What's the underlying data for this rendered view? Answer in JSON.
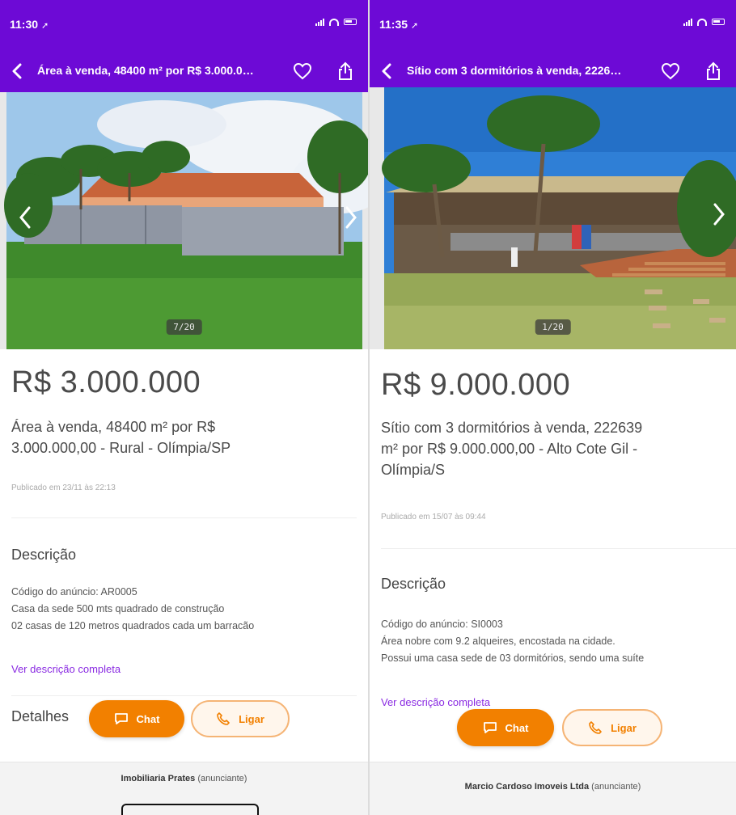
{
  "left": {
    "status": {
      "time": "11:30"
    },
    "header": {
      "title": "Área à venda, 48400 m² por R$ 3.000.000,00 - Rural - Olímpia/SP"
    },
    "gallery": {
      "counter": "7/20"
    },
    "listing": {
      "price": "R$ 3.000.000",
      "title_line1": "Área à venda, 48400 m² por R$",
      "title_line2": "3.000.000,00 - Rural - Olímpia/SP",
      "published": "Publicado em 23/11 às 22:13"
    },
    "description": {
      "heading": "Descrição",
      "lines": [
        "Código do anúncio: AR0005",
        "Casa da sede 500 mts quadrado de construção",
        "02 casas de 120 metros quadrados cada um barracão"
      ],
      "more_link": "Ver descrição completa"
    },
    "details": {
      "heading": "Detalhes"
    },
    "actions": {
      "chat_label": "Chat",
      "call_label": "Ligar"
    },
    "footer": {
      "advertiser_name": "Imobiliaria Prates",
      "advertiser_role": "(anunciante)"
    }
  },
  "right": {
    "status": {
      "time": "11:35"
    },
    "header": {
      "title": "Sítio com 3 dormitórios à venda, 222639 m²"
    },
    "gallery": {
      "counter": "1/20"
    },
    "listing": {
      "price": "R$ 9.000.000",
      "title_line1": "Sítio com 3 dormitórios à venda, 222639",
      "title_line2": "m² por R$ 9.000.000,00 - Alto Cote Gil -",
      "title_line3": "Olímpia/S",
      "published": "Publicado em 15/07 às 09:44"
    },
    "description": {
      "heading": "Descrição",
      "lines": [
        "Código do anúncio: SI0003",
        "Área nobre com 9.2 alqueires, encostada na cidade.",
        "Possui uma casa sede de 03 dormitórios, sendo uma suíte"
      ],
      "more_link": "Ver descrição completa"
    },
    "actions": {
      "chat_label": "Chat",
      "call_label": "Ligar"
    },
    "footer": {
      "advertiser_name": "Marcio Cardoso Imoveis Ltda",
      "advertiser_role": "(anunciante)"
    }
  },
  "colors": {
    "brand_purple": "#6d0ad6",
    "accent_orange": "#f28000",
    "link_purple": "#8a2be2"
  },
  "icons": [
    "back-arrow-icon",
    "heart-icon",
    "share-icon",
    "chevron-left-icon",
    "chevron-right-icon",
    "chat-icon",
    "phone-icon",
    "location-arrow-icon",
    "signal-icon",
    "wifi-icon",
    "battery-icon"
  ]
}
